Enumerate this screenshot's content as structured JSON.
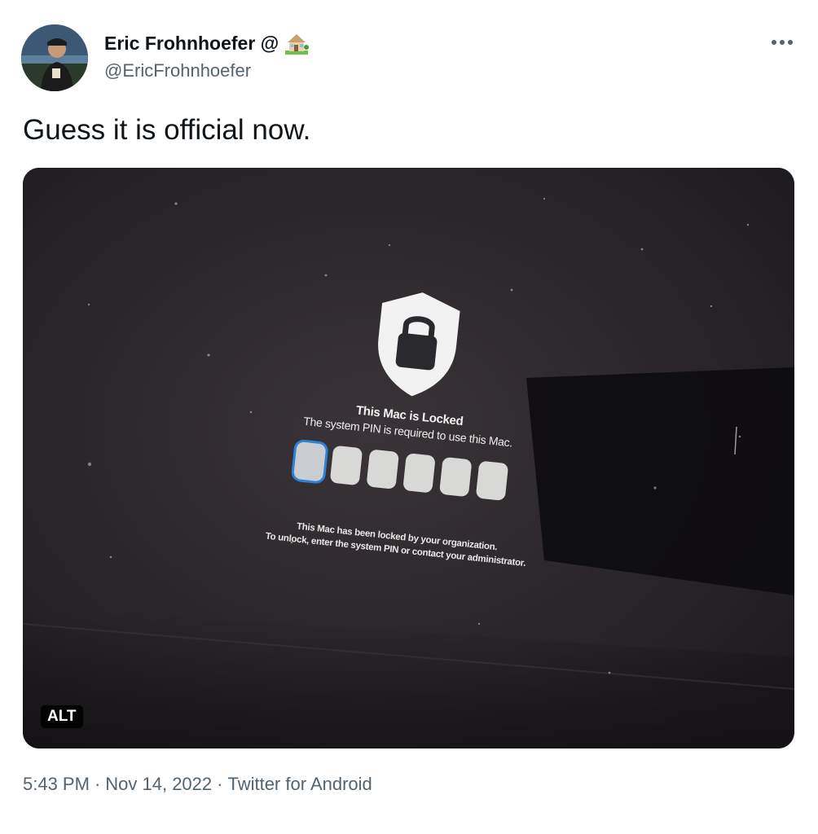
{
  "author": {
    "display_name": "Eric Frohnhoefer @",
    "handle": "@EricFrohnhoefer",
    "avatar_icon": "user-avatar",
    "name_emoji_icon": "house-icon"
  },
  "menu": {
    "more_icon": "more-horizontal-icon"
  },
  "tweet": {
    "text": "Guess it is official now."
  },
  "media": {
    "alt_badge": "ALT",
    "lock_screen": {
      "icon": "shield-lock-icon",
      "title": "This Mac is Locked",
      "subtitle": "The system PIN is required to use this Mac.",
      "pin_length": 6,
      "note_line1": "This Mac has been locked by your organization.",
      "note_line2": "To unlock, enter the system PIN or contact your administrator."
    }
  },
  "meta": {
    "time": "5:43 PM",
    "separator": "·",
    "date": "Nov 14, 2022",
    "source": "Twitter for Android"
  },
  "colors": {
    "text_primary": "#0f1419",
    "text_secondary": "#536471",
    "pin_focus": "#2a83d6"
  }
}
